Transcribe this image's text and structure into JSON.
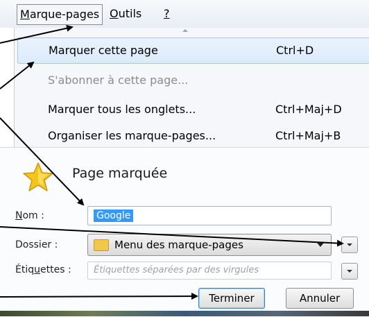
{
  "menubar": {
    "items": [
      {
        "mnemonic": "M",
        "rest": "arque-pages"
      },
      {
        "mnemonic": "O",
        "rest": "utils"
      },
      {
        "mnemonic": "?",
        "rest": ""
      }
    ]
  },
  "menu": {
    "items": [
      {
        "label": "Marquer cette page",
        "shortcut": "Ctrl+D",
        "state": "highlighted"
      },
      {
        "label": "S'abonner à cette page...",
        "shortcut": "",
        "state": "disabled"
      },
      {
        "label": "Marquer tous les onglets...",
        "shortcut": "Ctrl+Maj+D",
        "state": "normal"
      },
      {
        "label": "Organiser les marque-pages...",
        "shortcut": "Ctrl+Maj+B",
        "state": "normal"
      }
    ]
  },
  "dialog": {
    "title": "Page marquée",
    "name_label_mnemonic": "N",
    "name_label_rest": "om :",
    "name_value": "Google",
    "folder_label": "Dossier :",
    "folder_value": "Menu des marque-pages",
    "tags_label_pre": "Étiq",
    "tags_label_mnemonic": "u",
    "tags_label_post": "ettes :",
    "tags_placeholder": "Étiquettes séparées par des virgules",
    "done_button": "Terminer",
    "cancel_button": "Annuler"
  },
  "colors": {
    "highlight": "#dcebfb",
    "selection": "#3399ff",
    "star": "#f5c518"
  },
  "icons": [
    "star-icon",
    "folder-icon",
    "chevron-down-icon"
  ]
}
